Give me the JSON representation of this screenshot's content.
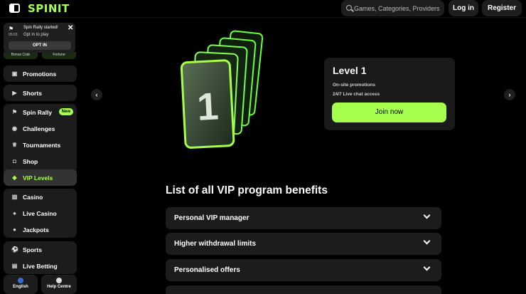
{
  "header": {
    "logo": "SPINIT",
    "search_placeholder": "Games, Categories, Providers",
    "login_label": "Log in",
    "register_label": "Register"
  },
  "notification": {
    "title": "Spin Rally started!",
    "time": "05:03",
    "subtitle": "Opt in to play",
    "button_label": "OPT IN"
  },
  "promo_chips": [
    "Bonus Crab",
    "Fortune"
  ],
  "sidebar": {
    "group1": [
      {
        "label": "Promotions",
        "icon": "megaphone-icon"
      }
    ],
    "group2": [
      {
        "label": "Shorts",
        "icon": "play-icon"
      }
    ],
    "group3": [
      {
        "label": "Spin Rally",
        "icon": "flag-icon",
        "badge": "New"
      },
      {
        "label": "Challenges",
        "icon": "challenge-icon"
      },
      {
        "label": "Tournaments",
        "icon": "trophy-icon"
      },
      {
        "label": "Shop",
        "icon": "shopping-bag-icon"
      },
      {
        "label": "VIP Levels",
        "icon": "diamond-icon",
        "active": true
      }
    ],
    "group4": [
      {
        "label": "Casino",
        "icon": "slot-icon"
      },
      {
        "label": "Live Casino",
        "icon": "cards-icon"
      },
      {
        "label": "Jackpots",
        "icon": "coins-icon"
      }
    ],
    "group5": [
      {
        "label": "Sports",
        "icon": "ball-icon"
      },
      {
        "label": "Live Betting",
        "icon": "live-icon"
      }
    ],
    "footer": {
      "language": "English",
      "help": "Help Centre"
    }
  },
  "level_card": {
    "title": "Level 1",
    "benefit_1": "On-site promotions",
    "benefit_2": "24/7 Live chat access",
    "join_label": "Join now",
    "card_number": "1"
  },
  "benefits": {
    "title": "List of all VIP program benefits",
    "items": [
      "Personal VIP manager",
      "Higher withdrawal limits",
      "Personalised offers"
    ]
  },
  "colors": {
    "accent": "#a6ff4d",
    "background": "#000000",
    "panel": "#1c1c1c"
  }
}
